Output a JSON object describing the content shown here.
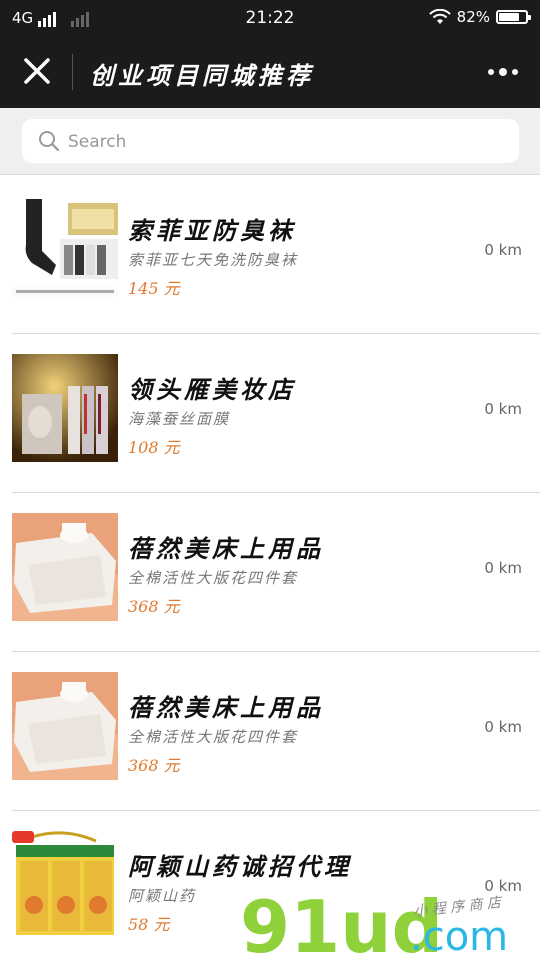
{
  "status": {
    "network": "4G",
    "time": "21:22",
    "battery": "82%",
    "battery_level": 0.82
  },
  "nav": {
    "title": "创业项目同城推荐",
    "close_icon": "close-icon",
    "more_icon": "more-dots-icon"
  },
  "search": {
    "placeholder": "Search",
    "value": ""
  },
  "items": [
    {
      "name": "索菲亚防臭袜",
      "desc": "索菲亚七天免洗防臭袜",
      "price": "145 元",
      "distance": "0 km",
      "thumb": "socks-product-image"
    },
    {
      "name": "领头雁美妆店",
      "desc": "海藻蚕丝面膜",
      "price": "108 元",
      "distance": "0 km",
      "thumb": "face-mask-product-image"
    },
    {
      "name": "蓓然美床上用品",
      "desc": "全棉活性大版花四件套",
      "price": "368 元",
      "distance": "0 km",
      "thumb": "bedding-product-image"
    },
    {
      "name": "蓓然美床上用品",
      "desc": "全棉活性大版花四件套",
      "price": "368 元",
      "distance": "0 km",
      "thumb": "bedding-product-image"
    },
    {
      "name": "阿颖山药诚招代理",
      "desc": "阿颖山药",
      "price": "58 元",
      "distance": "0 km",
      "thumb": "yam-gift-box-image"
    }
  ],
  "watermark": {
    "brand": "91ud.com",
    "tagline": "小程序商店"
  },
  "colors": {
    "bar_bg": "#1b1b1b",
    "price": "#e07a2e",
    "watermark_green": "#8fd13a",
    "watermark_blue": "#2ab7e6"
  }
}
